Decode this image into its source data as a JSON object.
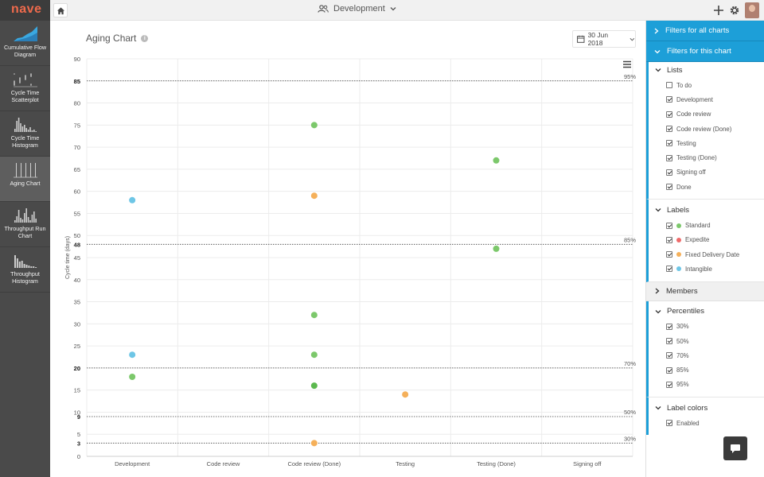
{
  "app": {
    "logo": "nave"
  },
  "sidebar": {
    "items": [
      {
        "label": "Cumulative Flow Diagram",
        "icon": "cumulative-flow-icon",
        "active": false
      },
      {
        "label": "Cycle Time Scatterplot",
        "icon": "scatterplot-icon",
        "active": false
      },
      {
        "label": "Cycle Time Histogram",
        "icon": "histogram-icon",
        "active": false
      },
      {
        "label": "Aging Chart",
        "icon": "aging-chart-icon",
        "active": true
      },
      {
        "label": "Throughput Run Chart",
        "icon": "run-chart-icon",
        "active": false
      },
      {
        "label": "Throughput Histogram",
        "icon": "throughput-histogram-icon",
        "active": false
      }
    ]
  },
  "topbar": {
    "board": "Development",
    "icons": [
      "home-icon",
      "team-icon",
      "chevron-down-icon",
      "plus-icon",
      "gear-icon",
      "avatar"
    ]
  },
  "main": {
    "title": "Aging Chart",
    "date": "30 Jun 2018"
  },
  "chart_data": {
    "type": "scatter",
    "title": "Aging Chart",
    "ylabel": "Cycle time (days)",
    "xlabel": "",
    "categories": [
      "Development",
      "Code review",
      "Code review (Done)",
      "Testing",
      "Testing (Done)",
      "Signing off"
    ],
    "ylim": [
      0,
      90
    ],
    "yticks": [
      0,
      5,
      10,
      15,
      20,
      25,
      30,
      35,
      40,
      45,
      50,
      55,
      60,
      65,
      70,
      75,
      80,
      85,
      90
    ],
    "grid": true,
    "percentiles": [
      {
        "label": "95%",
        "value": 85
      },
      {
        "label": "85%",
        "value": 48
      },
      {
        "label": "70%",
        "value": 20
      },
      {
        "label": "50%",
        "value": 9
      },
      {
        "label": "30%",
        "value": 3
      }
    ],
    "points": [
      {
        "category": "Development",
        "y": 58,
        "color": "#6ec6e6"
      },
      {
        "category": "Development",
        "y": 23,
        "color": "#6ec6e6"
      },
      {
        "category": "Development",
        "y": 18,
        "color": "#7cc86b"
      },
      {
        "category": "Code review (Done)",
        "y": 75,
        "color": "#7cc86b"
      },
      {
        "category": "Code review (Done)",
        "y": 59,
        "color": "#f5b05a"
      },
      {
        "category": "Code review (Done)",
        "y": 32,
        "color": "#7cc86b"
      },
      {
        "category": "Code review (Done)",
        "y": 23,
        "color": "#7cc86b"
      },
      {
        "category": "Code review (Done)",
        "y": 16,
        "color": "#5bb84e"
      },
      {
        "category": "Code review (Done)",
        "y": 3,
        "color": "#f5b05a"
      },
      {
        "category": "Testing",
        "y": 14,
        "color": "#f5b05a"
      },
      {
        "category": "Testing (Done)",
        "y": 67,
        "color": "#7cc86b"
      },
      {
        "category": "Testing (Done)",
        "y": 47,
        "color": "#7cc86b"
      }
    ]
  },
  "filters": {
    "all_charts": "Filters for all charts",
    "this_chart": "Filters for this chart",
    "lists": {
      "title": "Lists",
      "items": [
        {
          "label": "To do",
          "checked": false
        },
        {
          "label": "Development",
          "checked": true
        },
        {
          "label": "Code review",
          "checked": true
        },
        {
          "label": "Code review (Done)",
          "checked": true
        },
        {
          "label": "Testing",
          "checked": true
        },
        {
          "label": "Testing (Done)",
          "checked": true
        },
        {
          "label": "Signing off",
          "checked": true
        },
        {
          "label": "Done",
          "checked": true
        }
      ]
    },
    "labels": {
      "title": "Labels",
      "items": [
        {
          "label": "Standard",
          "checked": true,
          "color": "#7cc86b"
        },
        {
          "label": "Expedite",
          "checked": true,
          "color": "#ef6a6a"
        },
        {
          "label": "Fixed Delivery Date",
          "checked": true,
          "color": "#f5b05a"
        },
        {
          "label": "Intangible",
          "checked": true,
          "color": "#6ec6e6"
        }
      ]
    },
    "members": {
      "title": "Members"
    },
    "percentiles": {
      "title": "Percentiles",
      "items": [
        {
          "label": "30%",
          "checked": true
        },
        {
          "label": "50%",
          "checked": true
        },
        {
          "label": "70%",
          "checked": true
        },
        {
          "label": "85%",
          "checked": true
        },
        {
          "label": "95%",
          "checked": true
        }
      ]
    },
    "label_colors": {
      "title": "Label colors",
      "items": [
        {
          "label": "Enabled",
          "checked": true
        }
      ]
    }
  },
  "colors": {
    "accent": "#1d9fd8",
    "logo": "#ef6a4c",
    "sidebar": "#4a4a4a"
  }
}
